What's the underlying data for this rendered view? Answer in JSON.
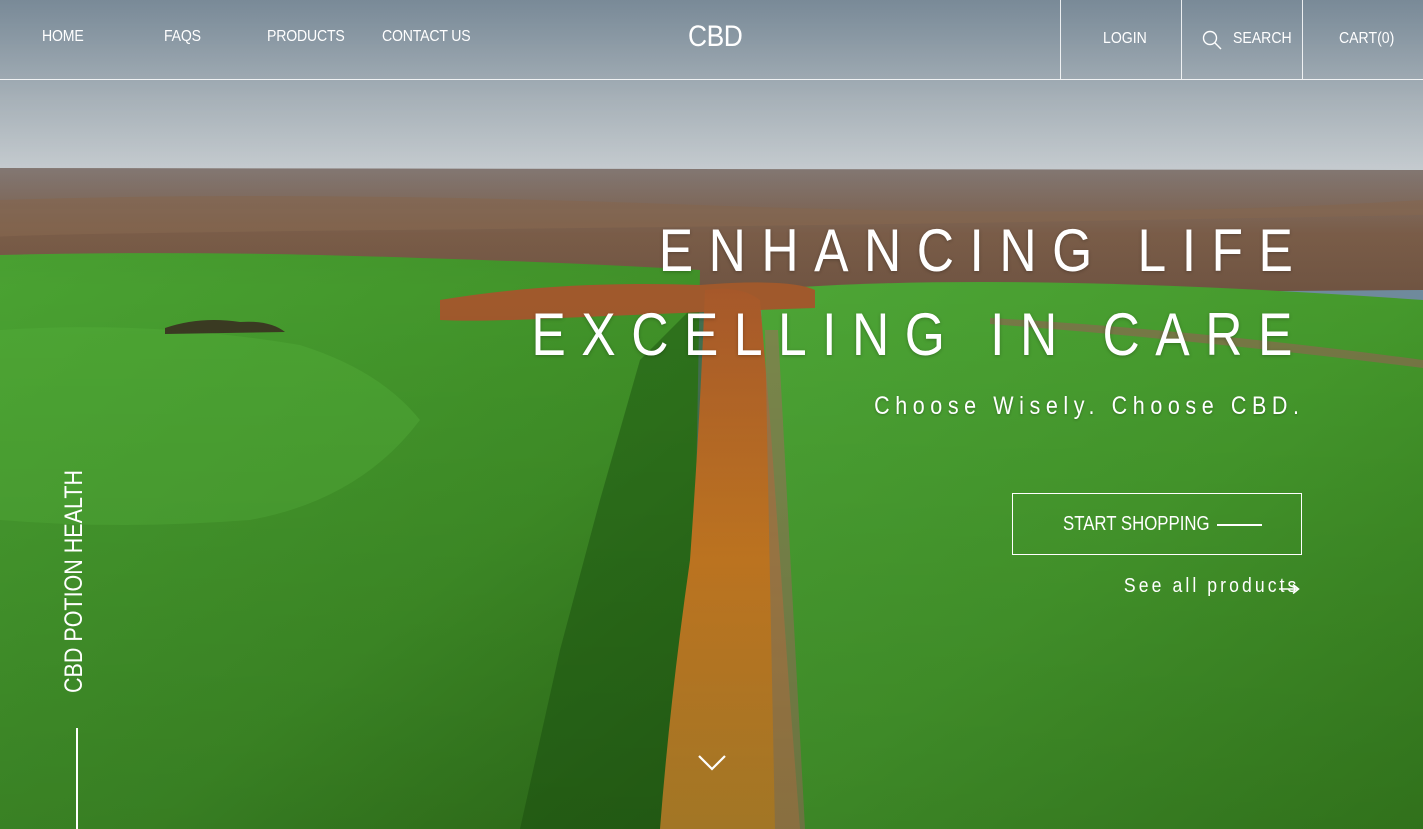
{
  "nav": {
    "home": "HOME",
    "faqs": "FAQS",
    "products": "PRODUCTS",
    "contact": "CONTACT US"
  },
  "brand": {
    "logo": "CBD"
  },
  "account": {
    "login": "LOGIN",
    "search": "SEARCH",
    "cart": "CART(0)"
  },
  "hero": {
    "headline_1": "ENHANCING LIFE",
    "headline_2": "EXCELLING IN CARE",
    "tagline": "Choose Wisely. Choose CBD.",
    "cta_label": "START SHOPPING",
    "see_all": "See all products",
    "side_label": "CBD POTION HEALTH"
  },
  "icons": {
    "search": "search-icon",
    "arrow": "arrow-right-icon",
    "scroll": "chevron-down-icon"
  },
  "colors": {
    "text": "#ffffff",
    "field_green": "#3f9b2c",
    "tree_orange": "#c8761f",
    "sky": "#c8d2da"
  }
}
